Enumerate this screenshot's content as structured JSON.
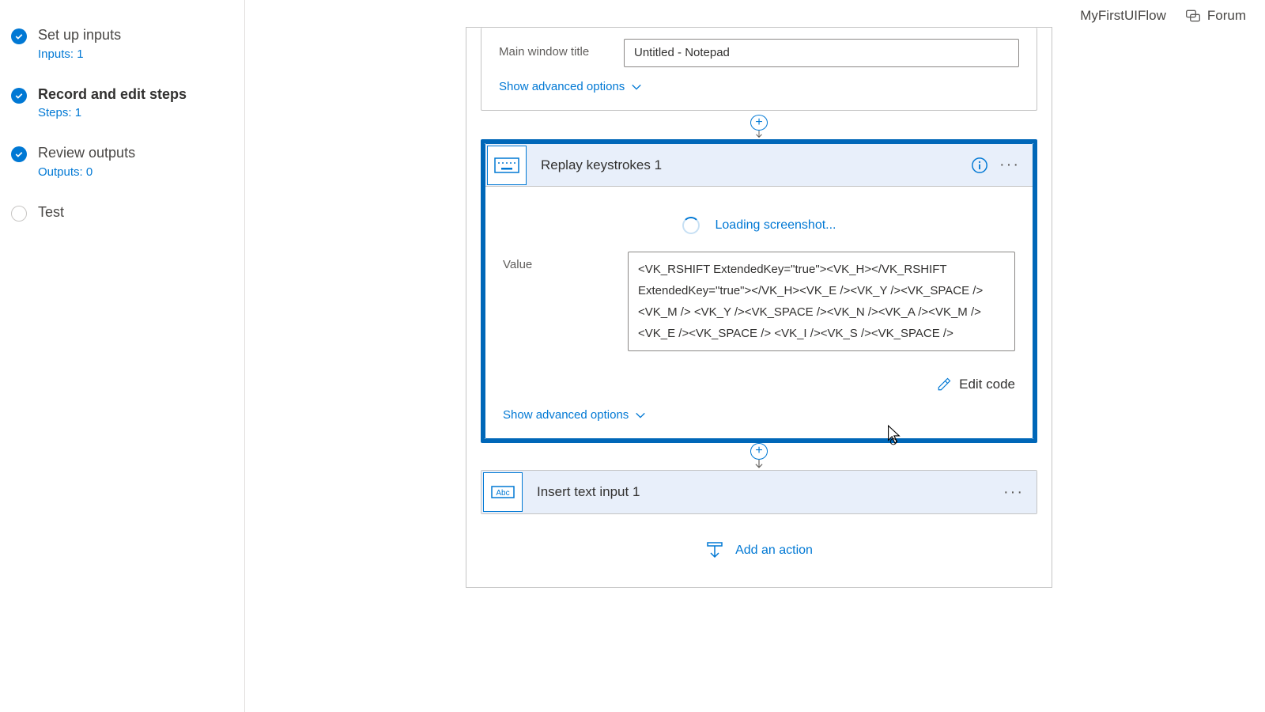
{
  "topbar": {
    "flowname": "MyFirstUIFlow",
    "forum": "Forum"
  },
  "sidebar": {
    "items": [
      {
        "title": "Set up inputs",
        "sub": "Inputs: 1",
        "done": true,
        "active": false
      },
      {
        "title": "Record and edit steps",
        "sub": "Steps: 1",
        "done": true,
        "active": true
      },
      {
        "title": "Review outputs",
        "sub": "Outputs: 0",
        "done": true,
        "active": false
      },
      {
        "title": "Test",
        "sub": "",
        "done": false,
        "active": false
      }
    ]
  },
  "card_top": {
    "field_label": "Main window title",
    "field_value": "Untitled - Notepad",
    "adv": "Show advanced options"
  },
  "card_keystrokes": {
    "title": "Replay keystrokes 1",
    "loading": "Loading screenshot...",
    "value_label": "Value",
    "value_text": "<VK_RSHIFT ExtendedKey=\"true\"><VK_H></VK_RSHIFT ExtendedKey=\"true\"></VK_H><VK_E /><VK_Y /><VK_SPACE /><VK_M /> <VK_Y /><VK_SPACE /><VK_N /><VK_A /><VK_M /><VK_E /><VK_SPACE /> <VK_I /><VK_S /><VK_SPACE />",
    "edit_code": "Edit code",
    "adv": "Show advanced options"
  },
  "card_text": {
    "title": "Insert text input 1"
  },
  "add_action": "Add an action"
}
